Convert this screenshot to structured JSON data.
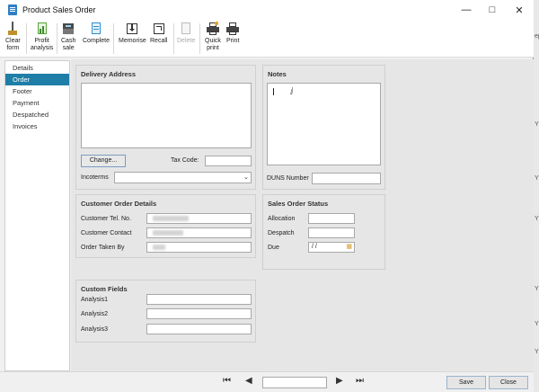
{
  "window": {
    "title": "Product Sales Order"
  },
  "toolbar": {
    "clear_form": [
      "Clear",
      "form"
    ],
    "profit_analysis": [
      "Profit",
      "analysis"
    ],
    "cash_sale": [
      "Cash",
      "sale"
    ],
    "complete": "Complete",
    "memorise": "Memorise",
    "recall": "Recall",
    "delete": "Delete",
    "quick_print": [
      "Quick",
      "print"
    ],
    "print": "Print"
  },
  "nav": {
    "items": [
      "Details",
      "Order",
      "Footer",
      "Payment",
      "Despatched",
      "Invoices"
    ],
    "active_index": 1
  },
  "delivery": {
    "title": "Delivery Address",
    "change_button": "Change...",
    "tax_code_label": "Tax Code:",
    "incoterms_label": "Incoterms"
  },
  "notes": {
    "title": "Notes",
    "duns_label": "DUNS Number"
  },
  "customer_order": {
    "title": "Customer Order Details",
    "tel_label": "Customer Tel. No.",
    "contact_label": "Customer Contact",
    "taken_by_label": "Order Taken By"
  },
  "status": {
    "title": "Sales Order Status",
    "allocation_label": "Allocation",
    "despatch_label": "Despatch",
    "due_label": "Due",
    "due_value": " / /"
  },
  "custom_fields": {
    "title": "Custom Fields",
    "analysis1": "Analysis1",
    "analysis2": "Analysis2",
    "analysis3": "Analysis3"
  },
  "bottom": {
    "save": "Save",
    "close": "Close"
  },
  "background_strip": [
    "ep",
    "Y",
    "Y",
    "Y",
    "Y",
    "Y",
    "Y"
  ]
}
